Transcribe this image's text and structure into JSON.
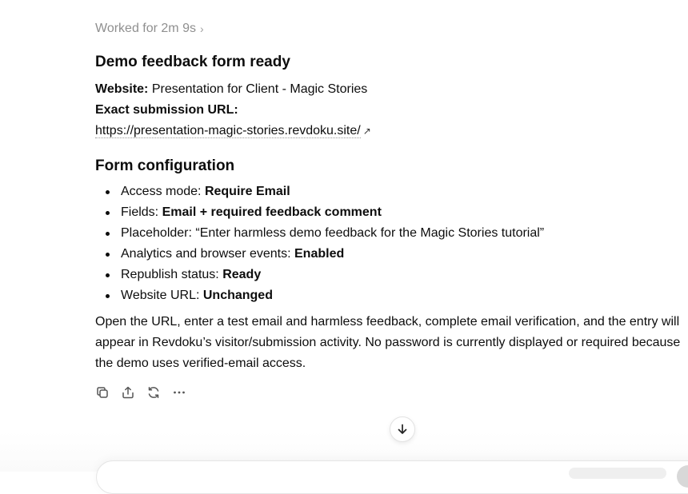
{
  "status": {
    "worked_label": "Worked for 2m 9s",
    "chevron": "›"
  },
  "section1": {
    "title": "Demo feedback form ready",
    "website_label": "Website:",
    "website_value": "Presentation for Client - Magic Stories",
    "url_label": "Exact submission URL:",
    "url": "https://presentation-magic-stories.revdoku.site/",
    "url_icon": "external-link-icon",
    "url_icon_glyph": "↗"
  },
  "section2": {
    "title": "Form configuration",
    "items": [
      {
        "label": "Access mode: ",
        "value": "Require Email",
        "bold": true
      },
      {
        "label": "Fields: ",
        "value": "Email + required feedback comment",
        "bold": true
      },
      {
        "label": "Placeholder: “Enter harmless demo feedback for the Magic Stories tutorial”",
        "value": "",
        "bold": false
      },
      {
        "label": "Analytics and browser events: ",
        "value": "Enabled",
        "bold": true
      },
      {
        "label": "Republish status: ",
        "value": "Ready",
        "bold": true
      },
      {
        "label": "Website URL: ",
        "value": "Unchanged",
        "bold": true
      }
    ]
  },
  "paragraph": {
    "lines": [
      "Open the URL, enter a test email and harmless feedback, complete email verification, and the entry will",
      "appear in Revdoku’s visitor/submission activity. No password is currently displayed or required because",
      "the demo uses verified-email access."
    ]
  },
  "actions": [
    {
      "name": "copy-icon"
    },
    {
      "name": "share-icon"
    },
    {
      "name": "regenerate-icon"
    },
    {
      "name": "more-icon"
    }
  ],
  "scroll_button": {
    "icon": "arrow-down-icon"
  }
}
